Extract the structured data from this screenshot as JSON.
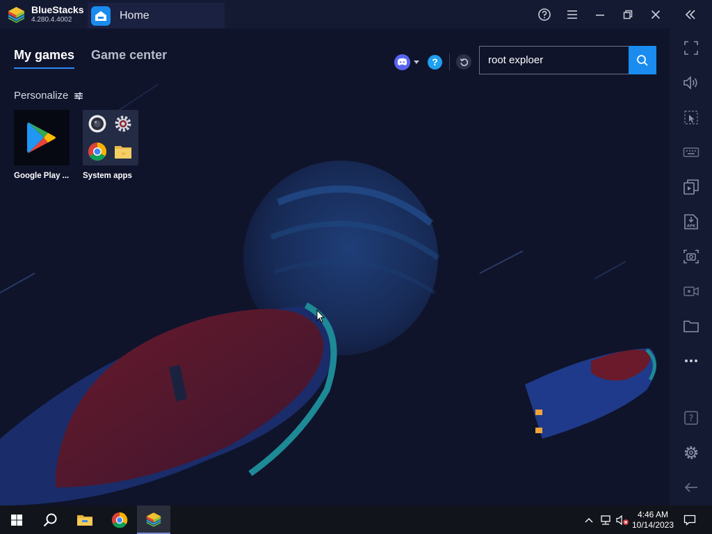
{
  "app": {
    "name": "BlueStacks",
    "version": "4.280.4.4002"
  },
  "titlebar": {
    "tab_label": "Home"
  },
  "main": {
    "tabs": [
      {
        "label": "My games",
        "active": true
      },
      {
        "label": "Game center",
        "active": false
      }
    ],
    "search": {
      "value": "root exploer"
    },
    "personalize_label": "Personalize",
    "apps": [
      {
        "label": "Google Play ...",
        "icon": "google-play-icon"
      },
      {
        "label": "System apps",
        "icon": "system-apps-folder-icon"
      }
    ]
  },
  "sidebar": {
    "items": [
      "fullscreen-icon",
      "volume-icon",
      "pointer-icon",
      "keyboard-icon",
      "multi-instance-icon",
      "apk-install-icon",
      "screenshot-icon",
      "screen-record-icon",
      "folder-icon",
      "more-icon",
      "help-icon",
      "settings-icon",
      "back-icon"
    ]
  },
  "taskbar": {
    "time": "4:46 AM",
    "date": "10/14/2023"
  },
  "colors": {
    "accent": "#1a8cf0",
    "background": "#0f142b",
    "chrome": "#151a33"
  }
}
